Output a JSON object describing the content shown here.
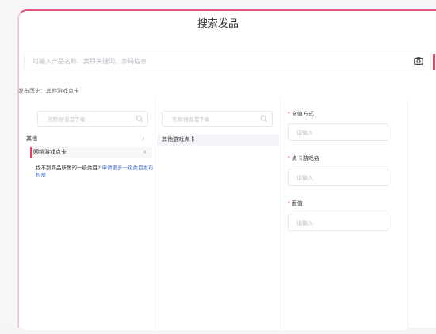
{
  "header": {
    "title": "搜索发品"
  },
  "search": {
    "placeholder": "可输入产品名称、类目关键词、条码信息"
  },
  "history": {
    "label": "发布历史:",
    "value": "其他游戏点卡"
  },
  "columns": {
    "left": {
      "search_placeholder": "名称/拼音首字母",
      "items": [
        {
          "label": "其他",
          "arrow": "›"
        },
        {
          "label": "网络游戏点卡",
          "arrow": "›",
          "selected": true
        }
      ],
      "hint_text": "找不到商品所属的一级类目?",
      "hint_link": "申请更多一级类目发布权限"
    },
    "middle": {
      "search_placeholder": "名称/拼音首字母",
      "items": [
        {
          "label": "其他游戏点卡",
          "selected": true
        }
      ]
    },
    "right": {
      "fields": [
        {
          "required": "*",
          "label": "充值方式",
          "placeholder": "请输入"
        },
        {
          "required": "*",
          "label": "点卡游戏名",
          "placeholder": "请输入"
        },
        {
          "required": "*",
          "label": "面值",
          "placeholder": "请输入"
        }
      ]
    }
  },
  "colors": {
    "accent": "#e2455e",
    "link": "#4a78d4"
  }
}
